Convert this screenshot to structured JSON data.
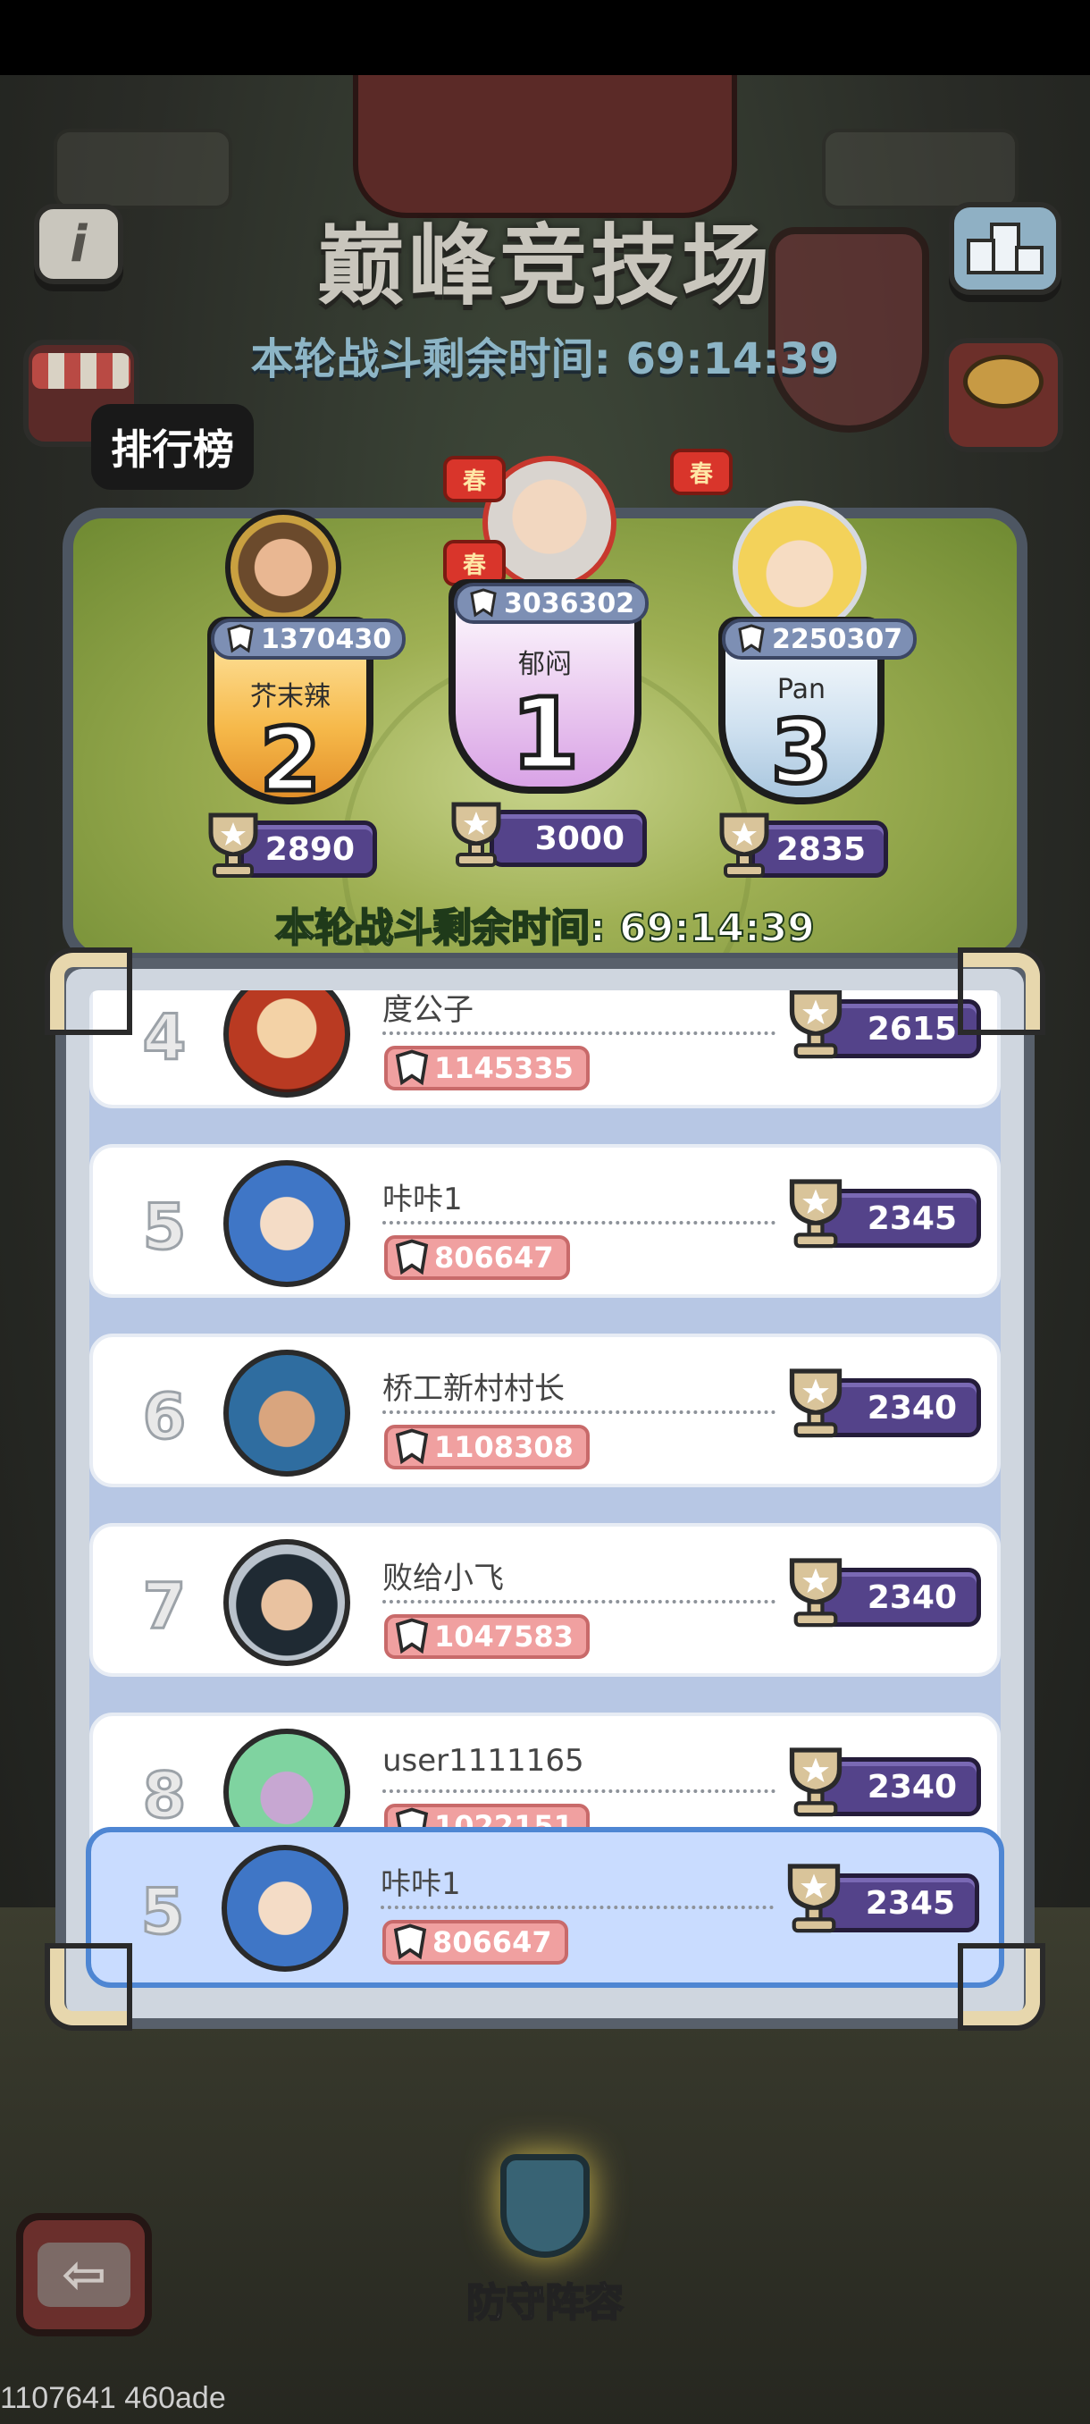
{
  "header": {
    "title": "巅峰竞技场",
    "timer": "本轮战斗剩余时间: 69:14:39"
  },
  "tabs": {
    "leaderboard": "排行榜"
  },
  "podium": {
    "timer": "本轮战斗剩余时间: 69:14:39",
    "festival_badge": "春",
    "players": [
      {
        "place": "1",
        "name": "郁闷",
        "power": "3036302",
        "trophies": "3000"
      },
      {
        "place": "2",
        "name": "芥末辣",
        "power": "1370430",
        "trophies": "2890"
      },
      {
        "place": "3",
        "name": "Pan",
        "power": "2250307",
        "trophies": "2835"
      }
    ]
  },
  "leaderboard": {
    "rows": [
      {
        "rank": "4",
        "name": "度公子",
        "power": "1145335",
        "trophies": "2615"
      },
      {
        "rank": "5",
        "name": "咔咔1",
        "power": "806647",
        "trophies": "2345"
      },
      {
        "rank": "6",
        "name": "桥工新村村长",
        "power": "1108308",
        "trophies": "2340"
      },
      {
        "rank": "7",
        "name": "败给小飞",
        "power": "1047583",
        "trophies": "2340"
      },
      {
        "rank": "8",
        "name": "user1111165",
        "power": "1022151",
        "trophies": "2340"
      }
    ],
    "self": {
      "rank": "5",
      "name": "咔咔1",
      "power": "806647",
      "trophies": "2345"
    }
  },
  "footer": {
    "defense_label": "防守阵容",
    "debug_text": "1107641 460ade"
  },
  "icons": {
    "info": "info-icon",
    "podium": "podium-icon",
    "shop": "shop-icon",
    "basket": "treasure-basket-icon",
    "back": "back-arrow-icon",
    "trophy": "trophy-icon",
    "power": "power-icon"
  },
  "colors": {
    "trophy_pill": "#54438a",
    "self_row": "#c9dcff",
    "power_pill": "#f0a0a0",
    "podium_bg": "#9fb054"
  }
}
